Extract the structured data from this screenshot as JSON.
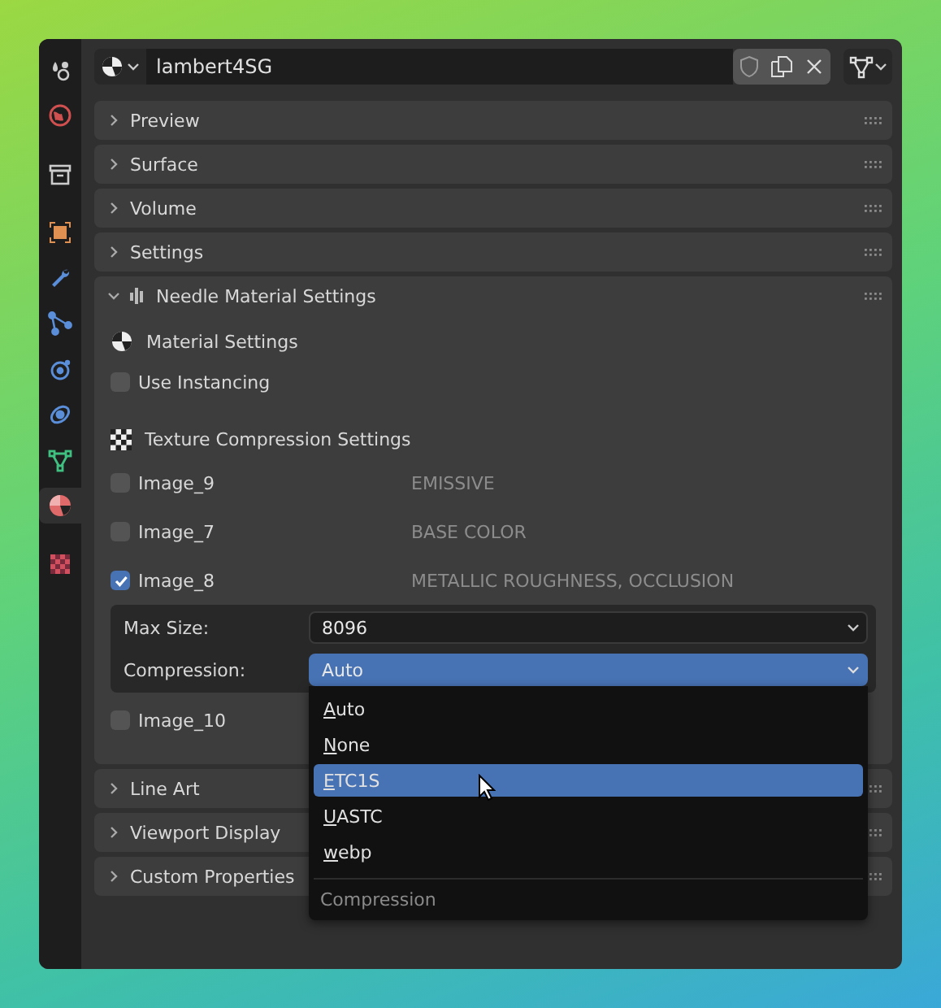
{
  "sidebar": {
    "tabs": [
      {
        "kind": "tool",
        "selected": false
      },
      {
        "kind": "world",
        "selected": false
      },
      {
        "kind": "collection",
        "selected": false
      },
      {
        "kind": "object",
        "selected": false
      },
      {
        "kind": "modifier",
        "selected": false
      },
      {
        "kind": "particles",
        "selected": false
      },
      {
        "kind": "physics",
        "selected": false
      },
      {
        "kind": "constraints",
        "selected": false
      },
      {
        "kind": "data",
        "selected": false
      },
      {
        "kind": "material",
        "selected": true
      },
      {
        "kind": "texture",
        "selected": false
      }
    ]
  },
  "header": {
    "material_name": "lambert4SG"
  },
  "panels": [
    {
      "title": "Preview",
      "expanded": false
    },
    {
      "title": "Surface",
      "expanded": false
    },
    {
      "title": "Volume",
      "expanded": false
    },
    {
      "title": "Settings",
      "expanded": false
    },
    {
      "title": "Needle Material Settings",
      "expanded": true,
      "content": {
        "material_settings": {
          "heading": "Material Settings",
          "use_instancing": {
            "label": "Use Instancing",
            "checked": false
          }
        },
        "texture_compression": {
          "heading": "Texture Compression Settings",
          "images": [
            {
              "name": "Image_9",
              "type": "EMISSIVE",
              "checked": false
            },
            {
              "name": "Image_7",
              "type": "BASE COLOR",
              "checked": false
            },
            {
              "name": "Image_8",
              "type": "METALLIC ROUGHNESS, OCCLUSION",
              "checked": true,
              "settings": {
                "max_size_label": "Max Size:",
                "max_size": "8096",
                "compression_label": "Compression:",
                "compression": "Auto",
                "open": true,
                "options": [
                  {
                    "label": "Auto",
                    "selected": false
                  },
                  {
                    "label": "None",
                    "selected": false
                  },
                  {
                    "label": "ETC1S",
                    "selected": true
                  },
                  {
                    "label": "UASTC",
                    "selected": false
                  },
                  {
                    "label": "webp",
                    "selected": false
                  }
                ],
                "footer": "Compression"
              }
            },
            {
              "name": "Image_10",
              "checked": false
            }
          ]
        }
      }
    },
    {
      "title": "Line Art",
      "expanded": false
    },
    {
      "title": "Viewport Display",
      "expanded": false
    },
    {
      "title": "Custom Properties",
      "expanded": false
    }
  ]
}
